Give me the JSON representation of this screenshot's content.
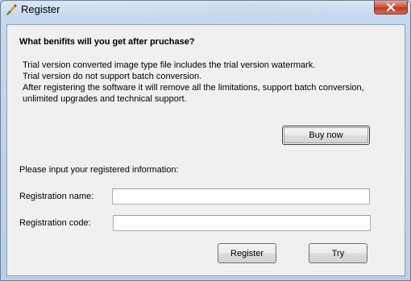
{
  "window": {
    "title": "Register",
    "close_icon": "close-icon"
  },
  "content": {
    "heading": "What benifits will you get after pruchase?",
    "lines": [
      "Trial version converted image type file includes the trial version watermark.",
      "Trial version do not support batch conversion.",
      "After registering the software it will remove all the limitations, support batch conversion,",
      "unlimited upgrades and technical support."
    ],
    "buy_now_label": "Buy now",
    "input_prompt": "Please input your registered information:",
    "registration_name_label": "Registration name:",
    "registration_name_value": "",
    "registration_code_label": "Registration code:",
    "registration_code_value": "",
    "register_label": "Register",
    "try_label": "Try"
  },
  "colors": {
    "close_button": "#c23a22",
    "client_background": "#f0f0f0"
  }
}
